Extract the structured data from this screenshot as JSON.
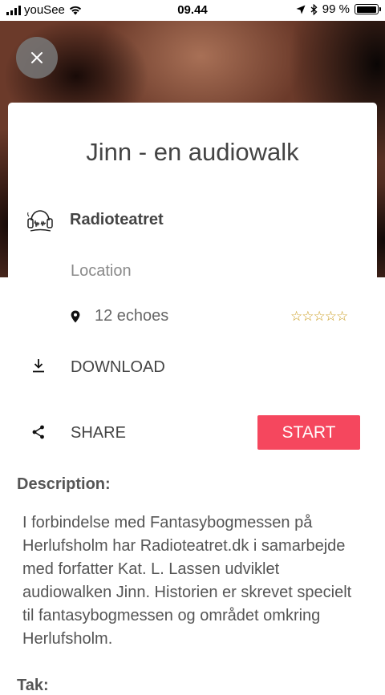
{
  "status_bar": {
    "carrier": "youSee",
    "time": "09.44",
    "battery_text": "99 %",
    "battery_level": 0.99
  },
  "hero": {
    "close_icon": "close-icon"
  },
  "walk": {
    "title": "Jinn - en audiowalk",
    "author": "Radioteatret",
    "location": "Location",
    "echoes": "12 echoes",
    "rating": 0,
    "rating_max": 5,
    "star_color": "#c99a1a"
  },
  "actions": {
    "download_label": "DOWNLOAD",
    "share_label": "SHARE",
    "start_label": "START",
    "start_color": "#f5475e"
  },
  "description": {
    "heading": "Description:",
    "body": "I forbindelse med Fantasybogmessen på Herlufsholm har Radioteatret.dk i samarbejde med forfatter Kat. L. Lassen udviklet audiowalken Jinn. Historien er skrevet specielt til fantasybogmessen og området omkring Herlufsholm."
  },
  "next_section": {
    "heading": "Tak:"
  }
}
